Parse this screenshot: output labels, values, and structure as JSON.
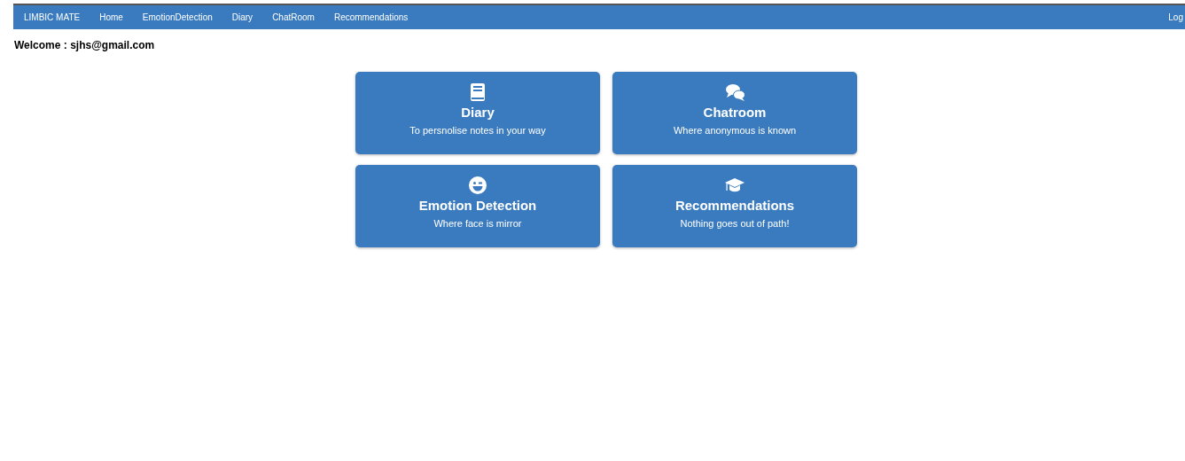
{
  "navbar": {
    "brand": "LIMBIC MATE",
    "links": [
      "Home",
      "EmotionDetection",
      "Diary",
      "ChatRoom",
      "Recommendations"
    ],
    "right_link": "Log"
  },
  "welcome": "Welcome : sjhs@gmail.com",
  "cards": [
    {
      "title": "Diary",
      "subtitle": "To persnolise notes in your way"
    },
    {
      "title": "Chatroom",
      "subtitle": "Where anonymous is known"
    },
    {
      "title": "Emotion Detection",
      "subtitle": "Where face is mirror"
    },
    {
      "title": "Recommendations",
      "subtitle": "Nothing goes out of path!"
    }
  ]
}
